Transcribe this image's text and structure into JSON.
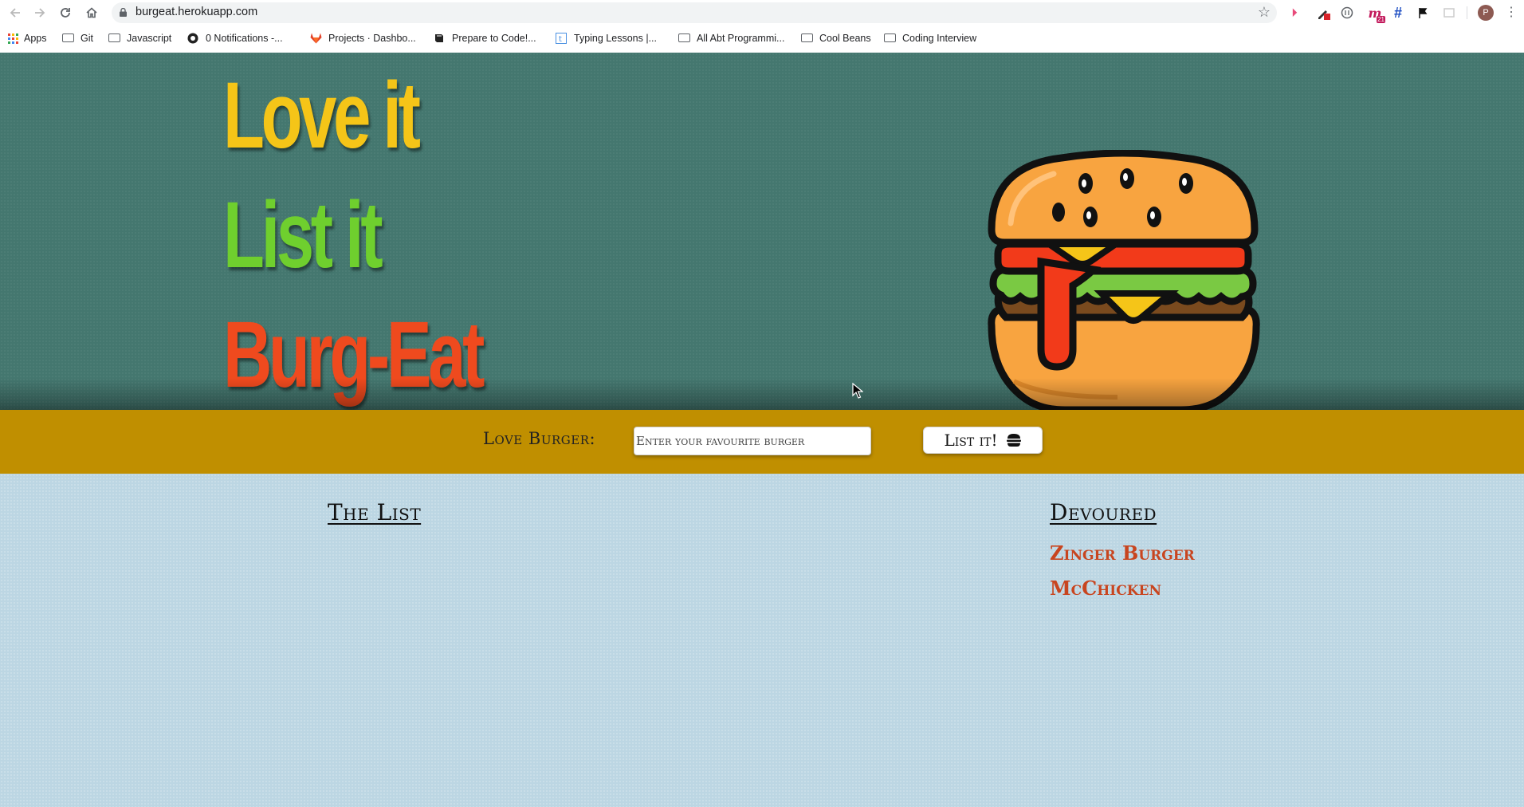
{
  "browser": {
    "url": "burgeat.herokuapp.com",
    "bookmarks": [
      {
        "label": "Apps",
        "icon": "apps-grid-icon"
      },
      {
        "label": "Git",
        "icon": "folder-icon"
      },
      {
        "label": "Javascript",
        "icon": "folder-icon"
      },
      {
        "label": "0 Notifications -...",
        "icon": "github-icon"
      },
      {
        "label": "Projects · Dashbo...",
        "icon": "gitlab-icon"
      },
      {
        "label": "Prepare to Code!...",
        "icon": "book-icon"
      },
      {
        "label": "Typing Lessons |...",
        "icon": "typing-icon"
      },
      {
        "label": "All Abt Programmi...",
        "icon": "folder-icon"
      },
      {
        "label": "Cool Beans",
        "icon": "folder-icon"
      },
      {
        "label": "Coding Interview",
        "icon": "folder-icon"
      }
    ],
    "extension_badge": "21",
    "profile_initial": "P"
  },
  "hero": {
    "line1": "Love it",
    "line2": "List it",
    "line3": "Burg-Eat",
    "colors": {
      "line1": "#f5c518",
      "line2": "#6fcf2e",
      "line3": "#ef4a1e",
      "background": "#44776f"
    }
  },
  "form": {
    "label": "Love Burger:",
    "input_placeholder": "Enter your favourite burger",
    "input_value": "",
    "button_label": "List it!"
  },
  "lists": {
    "list_title": "The List",
    "list_items": [],
    "devoured_title": "Devoured",
    "devoured_items": [
      "Zinger Burger",
      "McChicken"
    ]
  },
  "colors": {
    "formbar": "#c08f00",
    "content_background": "#bcd6e3",
    "devoured_text": "#c8451f"
  }
}
